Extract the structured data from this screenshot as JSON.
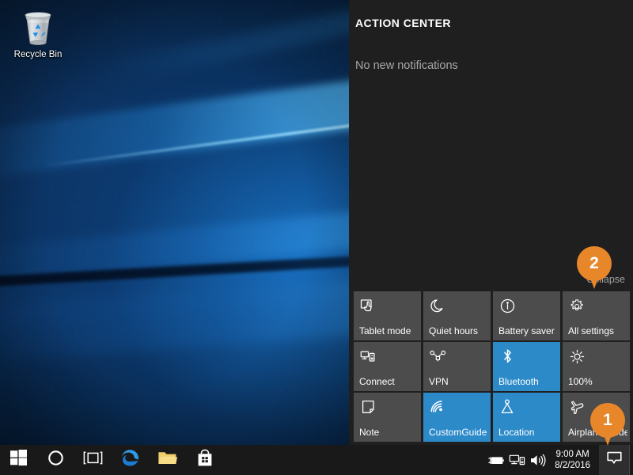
{
  "desktop": {
    "icons": [
      {
        "name": "recycle-bin",
        "label": "Recycle Bin"
      }
    ]
  },
  "action_center": {
    "title": "ACTION CENTER",
    "empty_message": "No new notifications",
    "collapse_label": "Collapse",
    "quick_actions": [
      {
        "label": "Tablet mode",
        "icon": "tablet-mode-icon",
        "active": false
      },
      {
        "label": "Quiet hours",
        "icon": "moon-icon",
        "active": false
      },
      {
        "label": "Battery saver",
        "icon": "battery-saver-icon",
        "active": false
      },
      {
        "label": "All settings",
        "icon": "gear-icon",
        "active": false
      },
      {
        "label": "Connect",
        "icon": "connect-icon",
        "active": false
      },
      {
        "label": "VPN",
        "icon": "vpn-icon",
        "active": false
      },
      {
        "label": "Bluetooth",
        "icon": "bluetooth-icon",
        "active": true
      },
      {
        "label": "100%",
        "icon": "brightness-icon",
        "active": false
      },
      {
        "label": "Note",
        "icon": "note-icon",
        "active": false
      },
      {
        "label": "CustomGuide",
        "icon": "wifi-icon",
        "active": true
      },
      {
        "label": "Location",
        "icon": "location-icon",
        "active": true
      },
      {
        "label": "Airplane mode",
        "icon": "airplane-icon",
        "active": false
      }
    ]
  },
  "taskbar": {
    "buttons": [
      {
        "name": "start-button",
        "icon": "windows-logo-icon"
      },
      {
        "name": "cortana-button",
        "icon": "cortana-circle-icon"
      },
      {
        "name": "task-view-button",
        "icon": "task-view-icon"
      },
      {
        "name": "edge-button",
        "icon": "edge-icon"
      },
      {
        "name": "file-explorer-button",
        "icon": "folder-icon"
      },
      {
        "name": "store-button",
        "icon": "store-bag-icon"
      }
    ],
    "tray": {
      "icons": [
        {
          "name": "battery-tray-icon",
          "icon": "battery-charging-icon"
        },
        {
          "name": "network-tray-icon",
          "icon": "monitor-network-icon"
        },
        {
          "name": "volume-tray-icon",
          "icon": "speaker-icon"
        }
      ],
      "clock": {
        "time": "9:00 AM",
        "date": "8/2/2016"
      },
      "action_center_button": {
        "icon": "speech-bubble-icon"
      }
    }
  },
  "callouts": [
    {
      "number": "1"
    },
    {
      "number": "2"
    }
  ],
  "colors": {
    "accent_blue": "#2d8ac9",
    "panel_bg": "#1f1f1f",
    "tile_bg": "#4c4c4c",
    "taskbar_bg": "#191919",
    "callout_orange": "#e8862a"
  }
}
